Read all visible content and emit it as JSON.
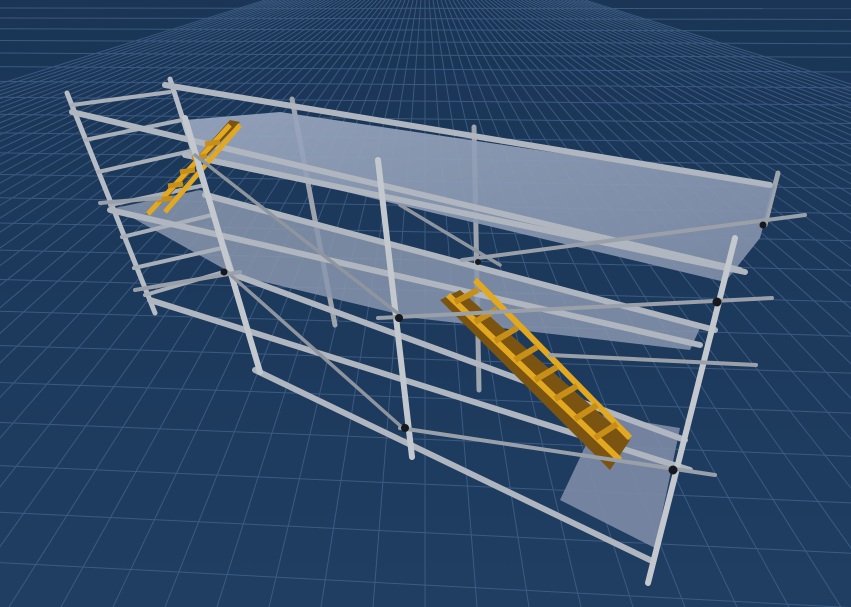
{
  "scene": {
    "background_color": "#1d3a5c",
    "grid_color": "#4c6b92",
    "deck_color": "#8796b0",
    "deck_light_color": "#a2b0c8",
    "frame_color": "#b9bec6",
    "frame_dark_color": "#7e848d",
    "stair_color": "#d9a21c",
    "stair_dark_color": "#7a5410",
    "joint_color": "#15181c"
  }
}
